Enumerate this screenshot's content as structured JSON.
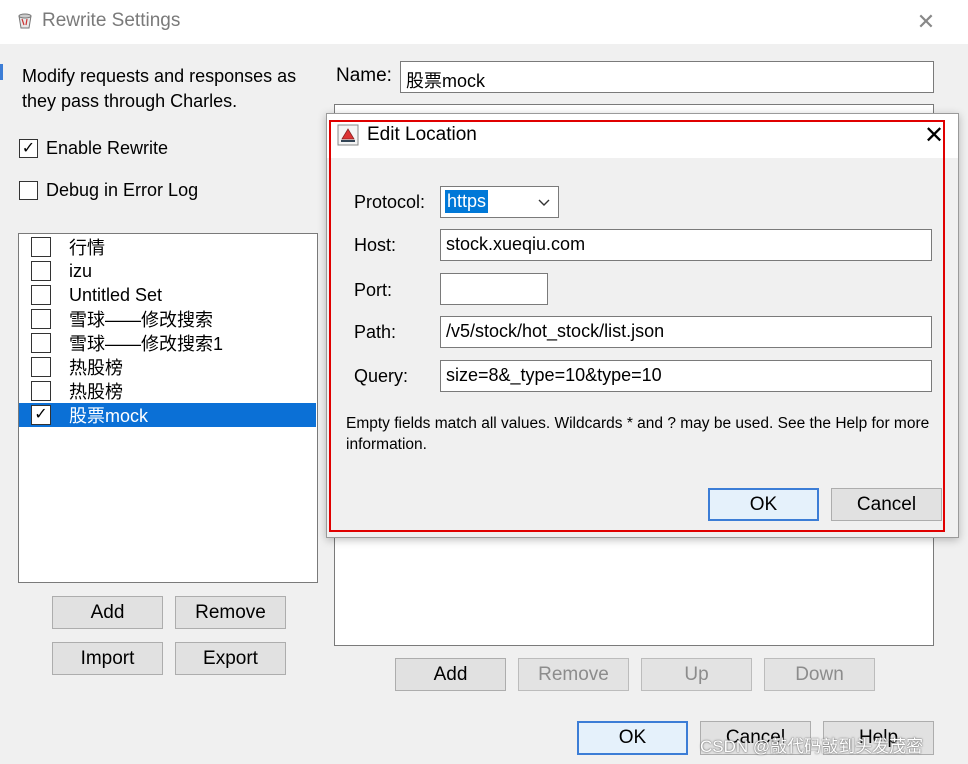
{
  "window": {
    "title": "Rewrite Settings",
    "close_glyph": "✕"
  },
  "sidebar": {
    "description": "Modify requests and responses as they pass through Charles.",
    "enable_rewrite": {
      "label": "Enable Rewrite",
      "checked": true
    },
    "debug_error_log": {
      "label": "Debug in Error Log",
      "checked": false
    },
    "sets": [
      {
        "label": "行情",
        "checked": false,
        "selected": false
      },
      {
        "label": "izu",
        "checked": false,
        "selected": false
      },
      {
        "label": "Untitled Set",
        "checked": false,
        "selected": false
      },
      {
        "label": "雪球——修改搜索",
        "checked": false,
        "selected": false
      },
      {
        "label": "雪球——修改搜索1",
        "checked": false,
        "selected": false
      },
      {
        "label": "热股榜",
        "checked": false,
        "selected": false
      },
      {
        "label": "热股榜",
        "checked": false,
        "selected": false
      },
      {
        "label": "股票mock",
        "checked": true,
        "selected": true
      }
    ],
    "add_label": "Add",
    "remove_label": "Remove",
    "import_label": "Import",
    "export_label": "Export"
  },
  "main": {
    "name_label": "Name:",
    "name_value": "股票mock",
    "add_label": "Add",
    "remove_label": "Remove",
    "up_label": "Up",
    "down_label": "Down",
    "ok_label": "OK",
    "cancel_label": "Cancel",
    "help_label": "Help"
  },
  "dialog": {
    "title": "Edit Location",
    "close_glyph": "✕",
    "protocol_label": "Protocol:",
    "protocol_value": "https",
    "host_label": "Host:",
    "host_value": "stock.xueqiu.com",
    "port_label": "Port:",
    "port_value": "",
    "path_label": "Path:",
    "path_value": "/v5/stock/hot_stock/list.json",
    "query_label": "Query:",
    "query_value": "size=8&_type=10&type=10",
    "hint": "Empty fields match all values. Wildcards * and ? may be used. See the Help for more information.",
    "ok_label": "OK",
    "cancel_label": "Cancel"
  },
  "watermark": "CSDN @敲代码敲到头发茂密",
  "colors": {
    "selection": "#0b70d6",
    "highlight_border": "#e00000",
    "focus_border": "#3c7dd6"
  },
  "icons": {
    "app": "charles-app-icon",
    "dialog": "java-cup-icon",
    "checkmark": "checkmark-icon",
    "dropdown": "chevron-down-icon"
  }
}
